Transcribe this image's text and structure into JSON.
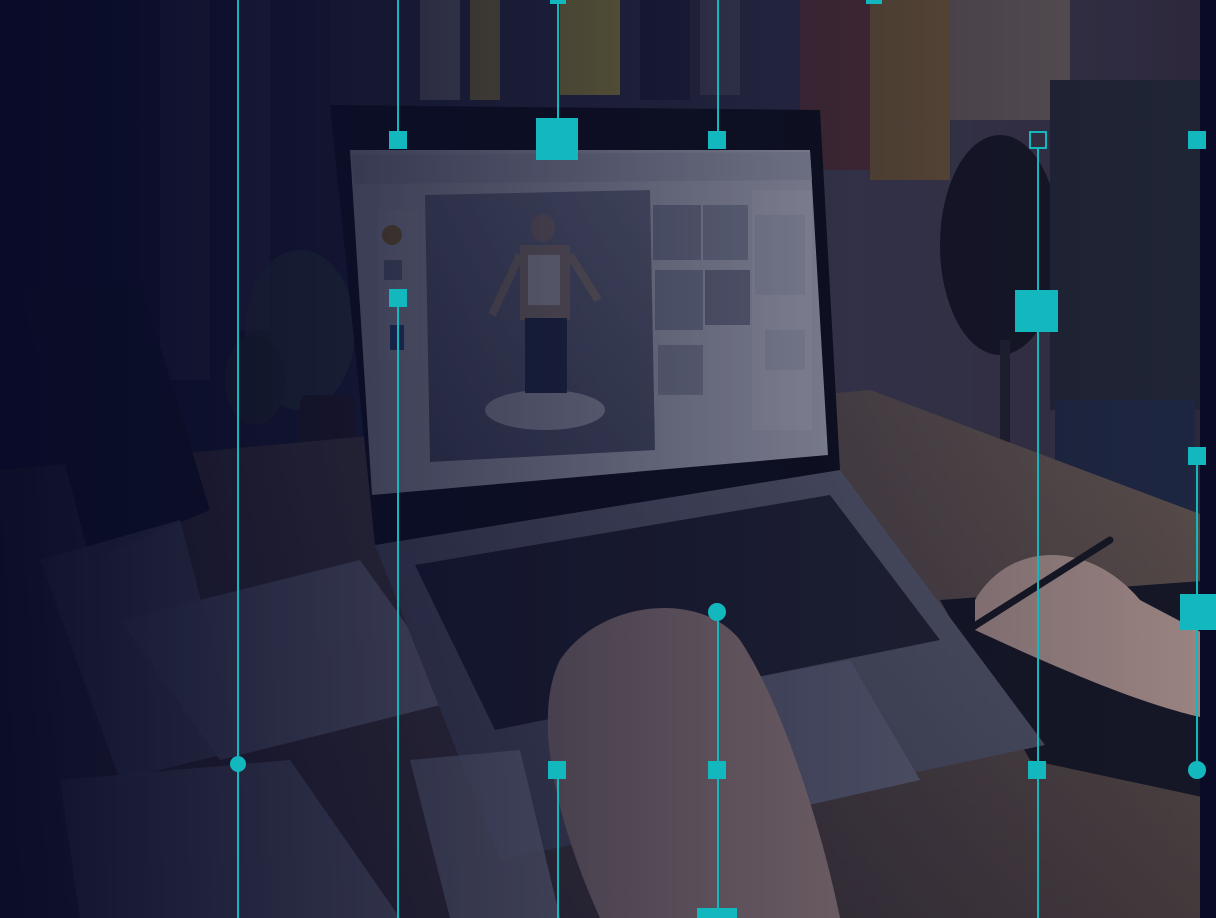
{
  "scene": {
    "subject": "photo-laptop-3d-garment-design",
    "overlay_color": "#13b8bf",
    "tint_color": "#0b0d2a"
  }
}
